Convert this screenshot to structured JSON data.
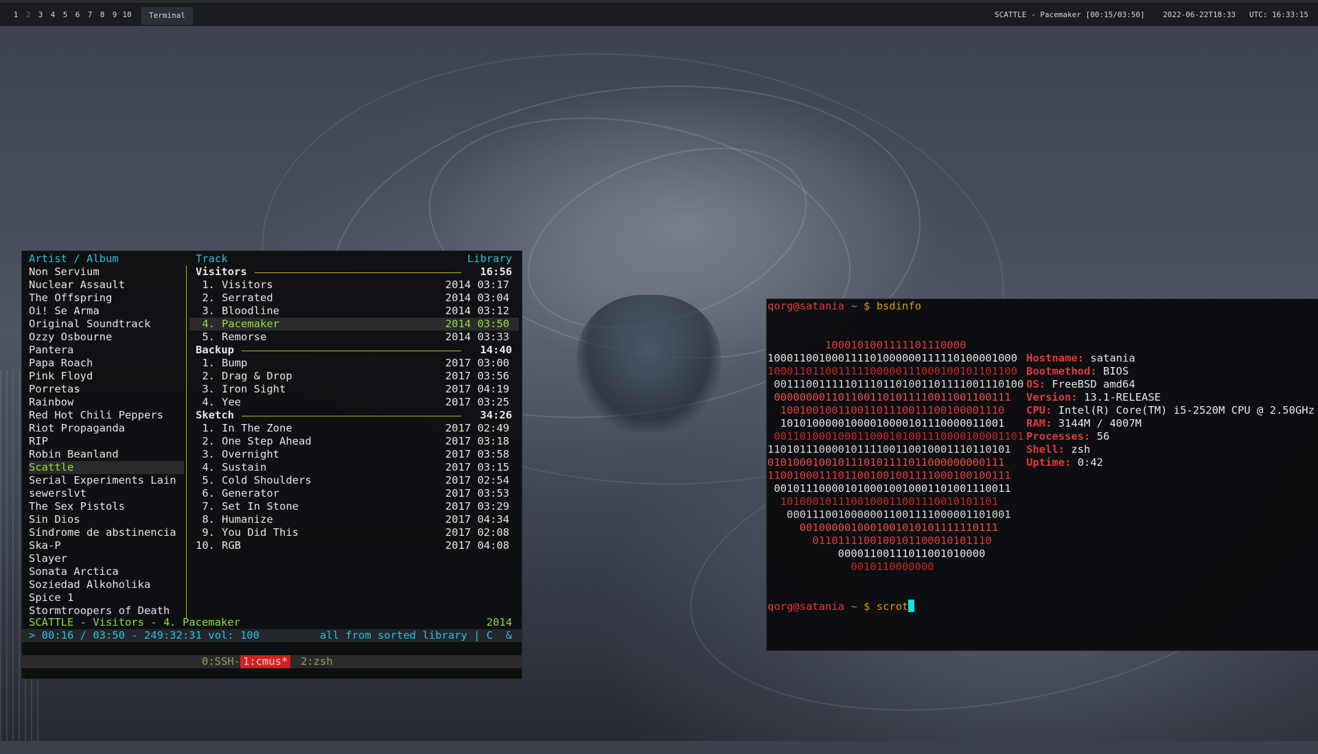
{
  "topbar": {
    "workspaces": [
      "1",
      "2",
      "3",
      "4",
      "5",
      "6",
      "7",
      "8",
      "9",
      "10"
    ],
    "window_title": "Terminal",
    "now_playing": "SCATTLE - Pacemaker [00:15/03:50]",
    "datetime": "2022-06-22T18:33",
    "utc": "UTC: 16:33:15"
  },
  "cmus": {
    "header_left": "Artist / Album",
    "header_mid": "Track",
    "header_right": "Library",
    "artists": [
      "Non Servium",
      "Nuclear Assault",
      "The Offspring",
      "Oi! Se Arma",
      "Original Soundtrack",
      "Ozzy Osbourne",
      "Pantera",
      "Papa Roach",
      "Pink Floyd",
      "Porretas",
      "Rainbow",
      "Red Hot Chili Peppers",
      "Riot Propaganda",
      "RIP",
      "Robin Beanland",
      "Scattle",
      "Serial Experiments Lain",
      "sewerslvt",
      "The Sex Pistols",
      "Sin Dios",
      "Síndrome de abstinencia",
      "Ska-P",
      "Slayer",
      "Sonata Arctica",
      "Soziedad Alkoholika",
      "Spice 1",
      "Stormtroopers of Death"
    ],
    "albums": [
      {
        "name": "Visitors",
        "total": "16:56",
        "tracks": [
          {
            "n": " 1.",
            "title": "Visitors",
            "year": "2014",
            "dur": "03:17"
          },
          {
            "n": " 2.",
            "title": "Serrated",
            "year": "2014",
            "dur": "03:04"
          },
          {
            "n": " 3.",
            "title": "Bloodline",
            "year": "2014",
            "dur": "03:12"
          },
          {
            "n": " 4.",
            "title": "Pacemaker",
            "year": "2014",
            "dur": "03:50"
          },
          {
            "n": " 5.",
            "title": "Remorse",
            "year": "2014",
            "dur": "03:33"
          }
        ]
      },
      {
        "name": "Backup",
        "total": "14:40",
        "tracks": [
          {
            "n": " 1.",
            "title": "Bump",
            "year": "2017",
            "dur": "03:00"
          },
          {
            "n": " 2.",
            "title": "Drag & Drop",
            "year": "2017",
            "dur": "03:56"
          },
          {
            "n": " 3.",
            "title": "Iron Sight",
            "year": "2017",
            "dur": "04:19"
          },
          {
            "n": " 4.",
            "title": "Yee",
            "year": "2017",
            "dur": "03:25"
          }
        ]
      },
      {
        "name": "Sketch",
        "total": "34:26",
        "tracks": [
          {
            "n": " 1.",
            "title": "In The Zone",
            "year": "2017",
            "dur": "02:49"
          },
          {
            "n": " 2.",
            "title": "One Step Ahead",
            "year": "2017",
            "dur": "03:18"
          },
          {
            "n": " 3.",
            "title": "Overnight",
            "year": "2017",
            "dur": "03:58"
          },
          {
            "n": " 4.",
            "title": "Sustain",
            "year": "2017",
            "dur": "03:15"
          },
          {
            "n": " 5.",
            "title": "Cold Shoulders",
            "year": "2017",
            "dur": "02:54"
          },
          {
            "n": " 6.",
            "title": "Generator",
            "year": "2017",
            "dur": "03:53"
          },
          {
            "n": " 7.",
            "title": "Set In Stone",
            "year": "2017",
            "dur": "03:29"
          },
          {
            "n": " 8.",
            "title": "Humanize",
            "year": "2017",
            "dur": "04:34"
          },
          {
            "n": " 9.",
            "title": "You Did This",
            "year": "2017",
            "dur": "02:08"
          },
          {
            "n": "10.",
            "title": "RGB",
            "year": "2017",
            "dur": "04:08"
          }
        ]
      }
    ],
    "now_playing_line": "SCATTLE - Visitors - 4. Pacemaker",
    "now_playing_year": "2014",
    "status_left": "> 00:16 / 03:50 - 249:32:31 vol: 100",
    "status_right": "all from sorted library | C  &",
    "tmux_tabs": [
      {
        "label": "0:SSH-",
        "active": false
      },
      {
        "label": "1:cmus*",
        "active": true
      },
      {
        "label": "2:zsh",
        "active": false
      }
    ]
  },
  "terminal": {
    "prompt_user": "qorg@satania",
    "prompt_path": "~",
    "prompt_sign": "$",
    "command1": "bsdinfo",
    "command2": "scrot",
    "logo_lines": [
      "         1000101001111101110000",
      "100011001000111101000000111110100001000",
      "100011011001111100000111000100101101100",
      " 001110011111011101101001101111001110100",
      " 0000000011011001101011110011001100111",
      "  10010010011001101110011100100001110",
      "  10101000001000010000101110000011001",
      " 001101000100011000101001110000100001101",
      "11010111000010111100110010001110110101",
      "0101000100101110101111011000000000111",
      "11001000111011001001001111000100100111",
      " 0010111000010100010010001101001110011",
      "  1010001011100100011001110010101101",
      "   00011100100000011001111000001101001",
      "     0010000010001001010101111110111",
      "       0110111100100101100010101110",
      "           00001100111011001010000",
      "             0010110000000"
    ],
    "info": [
      {
        "key": "Hostname:",
        "value": "satania"
      },
      {
        "key": "Bootmethod:",
        "value": "BIOS"
      },
      {
        "key": "OS:",
        "value": "FreeBSD amd64"
      },
      {
        "key": "Version:",
        "value": "13.1-RELEASE"
      },
      {
        "key": "CPU:",
        "value": "Intel(R) Core(TM) i5-2520M CPU @ 2.50GHz"
      },
      {
        "key": "RAM:",
        "value": "3144M / 4007M"
      },
      {
        "key": "Processes:",
        "value": "56"
      },
      {
        "key": "Shell:",
        "value": "zsh"
      },
      {
        "key": "Uptime:",
        "value": "0:42"
      }
    ]
  },
  "colors": {
    "cyan": "#25c2e0",
    "green": "#8fe03a",
    "amber": "#c8b400",
    "red": "#e23b3b",
    "tmux_active": "#d02020"
  }
}
